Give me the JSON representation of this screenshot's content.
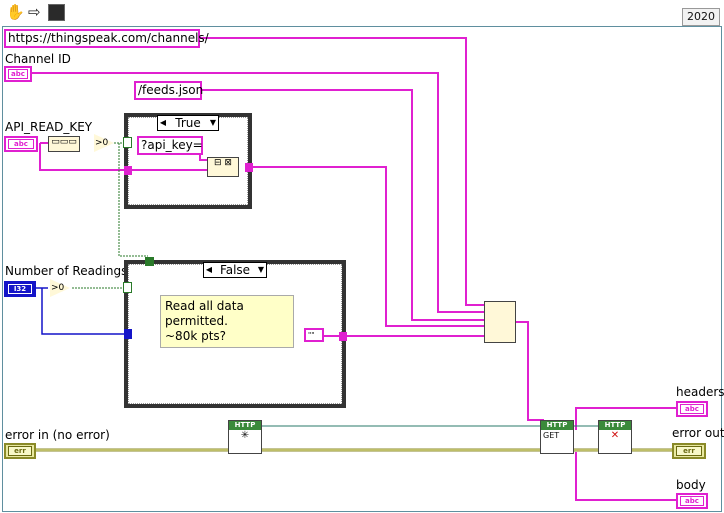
{
  "toolbar": {
    "run_icon": "hand-icon",
    "arrow_icon": "arrow-right-icon",
    "lv_icon": "labview-icon"
  },
  "version": "2020",
  "constants": {
    "url": "https://thingspeak.com/channels/",
    "feeds": "/feeds.json",
    "api_key": "?api_key="
  },
  "controls": {
    "channel_id": "Channel ID",
    "api_read_key": "API_READ_KEY",
    "num_readings": "Number of Readings",
    "error_in": "error in (no error)"
  },
  "indicators": {
    "headers": "headers",
    "error_out": "error out",
    "body": "body"
  },
  "types": {
    "string": "abc",
    "i32": "I32",
    "error": "err"
  },
  "case1": {
    "selector": "True"
  },
  "case2": {
    "selector": "False",
    "comment_line1": "Read all data permitted.",
    "comment_line2": "~80k pts?"
  },
  "nodes": {
    "compare_label": ">0",
    "http_header": "HTTP",
    "get_label": "GET"
  },
  "colors": {
    "string_wire": "#e020d0",
    "error_wire": "#8a8a28",
    "bool_wire": "#2a7a2a",
    "int_wire": "#1414c8",
    "refnum_wire": "#2a7a6a"
  }
}
